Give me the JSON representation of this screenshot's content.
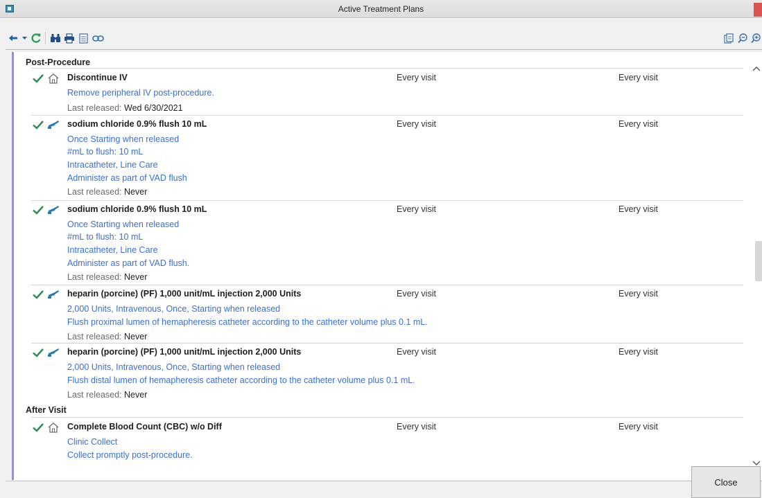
{
  "window": {
    "title": "Active Treatment Plans"
  },
  "toolbar": {
    "left_icons": [
      "back-arrow-icon",
      "dropdown-arrow-icon",
      "refresh-icon",
      "binoculars-icon",
      "print-icon",
      "document-icon",
      "link-icon"
    ],
    "right_icons": [
      "report-icon",
      "zoom-out-icon",
      "zoom-in-icon"
    ]
  },
  "sections": [
    {
      "title": "Post-Procedure",
      "orders": [
        {
          "icon": "home-icon",
          "title": "Discontinue IV",
          "freq1": "Every visit",
          "freq2": "Every visit",
          "details": [
            "Remove peripheral IV post-procedure."
          ],
          "released_label": "Last released:",
          "released_value": "Wed 6/30/2021"
        },
        {
          "icon": "syringe-icon",
          "title": "sodium chloride 0.9% flush 10 mL",
          "freq1": "Every visit",
          "freq2": "Every visit",
          "details": [
            "Once Starting when released",
            "#mL to flush: 10 mL",
            "Intracatheter, Line Care",
            "Administer as part of VAD flush"
          ],
          "released_label": "Last released:",
          "released_value": "Never"
        },
        {
          "icon": "syringe-icon",
          "title": "sodium chloride 0.9% flush 10 mL",
          "freq1": "Every visit",
          "freq2": "Every visit",
          "details": [
            "Once Starting when released",
            "#mL to flush: 10 mL",
            "Intracatheter, Line Care",
            "Administer as part of VAD flush."
          ],
          "released_label": "Last released:",
          "released_value": "Never"
        },
        {
          "icon": "syringe-icon",
          "title": "heparin (porcine) (PF) 1,000 unit/mL injection 2,000 Units",
          "freq1": "Every visit",
          "freq2": "Every visit",
          "details": [
            "2,000 Units, Intravenous, Once, Starting when released",
            "Flush proximal lumen of hemapheresis catheter according to the catheter volume plus 0.1 mL."
          ],
          "released_label": "Last released:",
          "released_value": "Never"
        },
        {
          "icon": "syringe-icon",
          "title": "heparin (porcine) (PF) 1,000 unit/mL injection 2,000 Units",
          "freq1": "Every visit",
          "freq2": "Every visit",
          "details": [
            "2,000 Units, Intravenous, Once, Starting when released",
            "Flush distal lumen of hemapheresis catheter according to the catheter volume plus 0.1 mL."
          ],
          "released_label": "Last released:",
          "released_value": "Never"
        }
      ]
    },
    {
      "title": "After Visit",
      "orders": [
        {
          "icon": "home-icon",
          "title": "Complete Blood Count (CBC) w/o Diff",
          "freq1": "Every visit",
          "freq2": "Every visit",
          "details": [
            "Clinic Collect",
            "Collect promptly post-procedure."
          ]
        }
      ]
    }
  ],
  "footer": {
    "close_label": "Close"
  },
  "colors": {
    "accent": "#8f8ff0",
    "link_blue": "#3a6fd8",
    "check_green": "#2e8b57",
    "syringe_blue": "#2a7ab8"
  }
}
